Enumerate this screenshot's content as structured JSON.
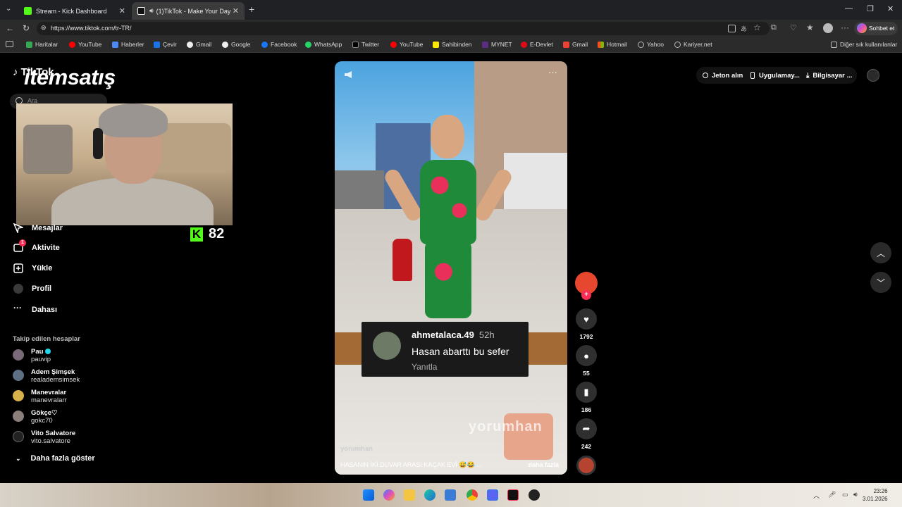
{
  "browser": {
    "tabs": [
      {
        "title": "Stream - Kick Dashboard",
        "color": "#53fc18"
      },
      {
        "title": "(1)TikTok - Make Your Day",
        "color": "#ffffff"
      }
    ],
    "url": "https://www.tiktok.com/tr-TR/",
    "copilot_label": "Sohbet et",
    "bookmarks": [
      "Haritalar",
      "YouTube",
      "Haberler",
      "Çevir",
      "Gmail",
      "Google",
      "Facebook",
      "WhatsApp",
      "Twitter",
      "YouTube",
      "Sahibinden",
      "MYNET",
      "E-Devlet",
      "Gmail",
      "Hotmail",
      "Yahoo",
      "Kariyer.net"
    ],
    "other_bookmarks": "Diğer sık kullanılanlar"
  },
  "tiktok": {
    "logo": "TikTok",
    "search_placeholder": "Ara",
    "nav": {
      "messages": "Mesajlar",
      "activity": "Aktivite",
      "activity_badge": "1",
      "upload": "Yükle",
      "profile": "Profil",
      "more": "Dahası"
    },
    "following_title": "Takip edilen hesaplar",
    "accounts": [
      {
        "name": "Pau",
        "handle": "pauvip"
      },
      {
        "name": "Adem Şimşek",
        "handle": "realademsimsek"
      },
      {
        "name": "Manevralar",
        "handle": "manevralarr"
      },
      {
        "name": "Gökçe♡",
        "handle": "gokc70"
      },
      {
        "name": "Vito Salvatore",
        "handle": "vito.salvatore"
      }
    ],
    "show_more": "Daha fazla göster",
    "top_right": {
      "coins": "Jeton alın",
      "app": "Uygulamay...",
      "computer": "Bilgisayar ..."
    },
    "video": {
      "author": "yorumhan",
      "caption": "HASANIN İKİ DUVAR ARASI KAÇAK EVİ 😅😂 ...",
      "more": "daha fazla",
      "sticker_text": "yorumhan"
    },
    "comment": {
      "user": "ahmetalaca.49",
      "time": "52h",
      "text": "Hasan abarttı bu sefer",
      "reply": "Yanıtla"
    },
    "actions": {
      "likes": "1792",
      "comments": "55",
      "saves": "186",
      "shares": "242"
    }
  },
  "overlay": {
    "brand": "itemsatış",
    "kick_viewers": "82"
  },
  "taskbar": {
    "time": "23:26",
    "date": "3.01.2026"
  }
}
